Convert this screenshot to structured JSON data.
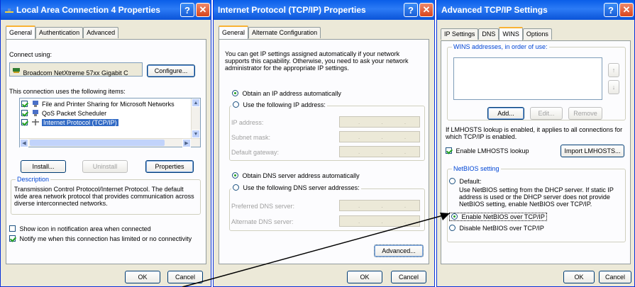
{
  "left": {
    "title": "Local Area Connection 4 Properties",
    "tabs": [
      "General",
      "Authentication",
      "Advanced"
    ],
    "connect_using_label": "Connect using:",
    "adapter": "Broadcom NetXtreme 57xx Gigabit C",
    "configure_button": "Configure...",
    "items_label": "This connection uses the following items:",
    "items": [
      {
        "label": "File and Printer Sharing for Microsoft Networks",
        "checked": true
      },
      {
        "label": "QoS Packet Scheduler",
        "checked": true
      },
      {
        "label": "Internet Protocol (TCP/IP)",
        "checked": true,
        "selected": true
      }
    ],
    "install_button": "Install...",
    "uninstall_button": "Uninstall",
    "properties_button": "Properties",
    "description_label": "Description",
    "description_text": "Transmission Control Protocol/Internet Protocol. The default wide area network protocol that provides communication across diverse interconnected networks.",
    "show_icon_label": "Show icon in notification area when connected",
    "notify_label": "Notify me when this connection has limited or no connectivity",
    "ok_button": "OK",
    "cancel_button": "Cancel"
  },
  "middle": {
    "title": "Internet Protocol (TCP/IP) Properties",
    "tabs": [
      "General",
      "Alternate Configuration"
    ],
    "intro_text": "You can get IP settings assigned automatically if your network supports this capability. Otherwise, you need to ask your network administrator for the appropriate IP settings.",
    "obtain_ip_label": "Obtain an IP address automatically",
    "use_ip_label": "Use the following IP address:",
    "ip_address_label": "IP address:",
    "subnet_label": "Subnet mask:",
    "gateway_label": "Default gateway:",
    "obtain_dns_label": "Obtain DNS server address automatically",
    "use_dns_label": "Use the following DNS server addresses:",
    "preferred_dns_label": "Preferred DNS server:",
    "alternate_dns_label": "Alternate DNS server:",
    "field_dots": ". . .",
    "advanced_button": "Advanced...",
    "ok_button": "OK",
    "cancel_button": "Cancel"
  },
  "right": {
    "title": "Advanced TCP/IP Settings",
    "tabs": [
      "IP Settings",
      "DNS",
      "WINS",
      "Options"
    ],
    "wins_label": "WINS addresses, in order of use:",
    "add_button": "Add...",
    "edit_button": "Edit...",
    "remove_button": "Remove",
    "lmhosts_text": "If LMHOSTS lookup is enabled, it applies to all connections for which TCP/IP is enabled.",
    "enable_lmhosts_label": "Enable LMHOSTS lookup",
    "import_button": "Import LMHOSTS...",
    "netbios_label": "NetBIOS setting",
    "default_label": "Default:",
    "default_desc": "Use NetBIOS setting from the DHCP server. If static IP address is used or the DHCP server does not provide NetBIOS setting, enable NetBIOS over TCP/IP.",
    "enable_netbios_label": "Enable NetBIOS over TCP/IP",
    "disable_netbios_label": "Disable NetBIOS over TCP/IP",
    "ok_button": "OK",
    "cancel_button": "Cancel"
  },
  "colors": {
    "titlebar": "#0a5ee8",
    "dialog_bg": "#ece9d8",
    "panel_bg": "#fcfcfe",
    "selection": "#316ac5",
    "group_label": "#0046d5"
  }
}
